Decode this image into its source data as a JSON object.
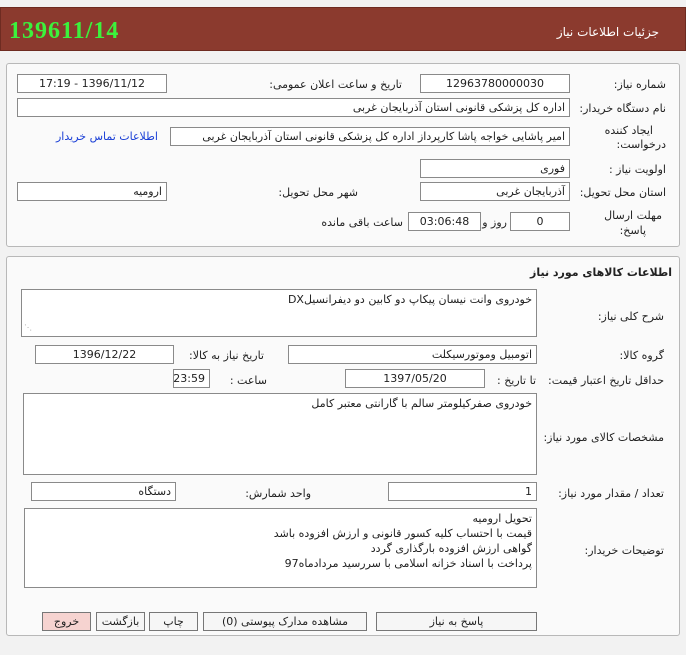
{
  "header": {
    "title": "جزئیات اطلاعات نیاز",
    "need_number_display": "139611/14"
  },
  "info": {
    "need_number_label": "شماره نیاز:",
    "need_number": "12963780000030",
    "announce_label": "تاریخ و ساعت اعلان عمومی:",
    "announce_value": "1396/11/12 - 17:19",
    "buyer_label": "نام دستگاه خریدار:",
    "buyer_value": "اداره کل پزشکی قانونی استان آذربایجان غربی",
    "creator_label_1": "ایجاد کننده",
    "creator_label_2": "درخواست:",
    "creator_value": "امیر پاشایی خواجه پاشا کارپرداز اداره کل پزشکی قانونی استان آذربایجان غربی",
    "contact_link": "اطلاعات تماس خریدار",
    "priority_label": "اولویت نیاز :",
    "priority_value": "فوری",
    "province_label": "استان محل تحویل:",
    "province_value": "آذربایجان غربی",
    "city_label": "شهر محل تحویل:",
    "city_value": "ارومیه",
    "deadline_label_1": "مهلت ارسال",
    "deadline_label_2": "پاسخ:",
    "days_value": "0",
    "days_label": "روز و",
    "time_value": "03:06:48",
    "remaining_label": "ساعت باقی مانده"
  },
  "goods": {
    "section_title": "اطلاعات کالاهای مورد نیاز",
    "desc_label": "شرح کلی نیاز:",
    "desc_value": "خودروی وانت نیسان پیکاپ دو کابین دو دیفرانسیلDX",
    "group_label": "گروه کالا:",
    "group_value": "اتومبیل وموتورسیکلت",
    "need_date_label": "تاریخ نیاز به کالا:",
    "need_date_value": "1396/12/22",
    "min_price_label": "حداقل تاریخ اعتبار قیمت:",
    "until_label": "تا تاریخ :",
    "until_value": "1397/05/20",
    "hour_label": "ساعت :",
    "hour_value": "23:59",
    "specs_label": "مشخصات کالای مورد نیاز:",
    "specs_value": "خودروی صفرکیلومتر سالم با گارانتی معتبر کامل",
    "qty_label": "تعداد / مقدار مورد نیاز:",
    "qty_value": "1",
    "unit_label": "واحد شمارش:",
    "unit_value": "دستگاه",
    "notes_label": "توضیحات خریدار:",
    "notes_lines": [
      "تحویل ارومیه",
      "قیمت با احتساب کلیه کسور قانونی و ارزش افزوده باشد",
      "گواهی ارزش افزوده بارگذاری گردد",
      "پرداخت با اسناد خزانه اسلامی با سررسید مردادماه97"
    ]
  },
  "buttons": {
    "reply": "پاسخ به نیاز",
    "attachments": "مشاهده مدارک پیوستی (0)",
    "print": "چاپ",
    "back": "بازگشت",
    "exit": "خروج"
  },
  "colors": {
    "header_bg": "#8b3a2e",
    "header_number": "#3cf23c",
    "link": "#1a3fd6",
    "exit_button": "#f6d3d0"
  }
}
